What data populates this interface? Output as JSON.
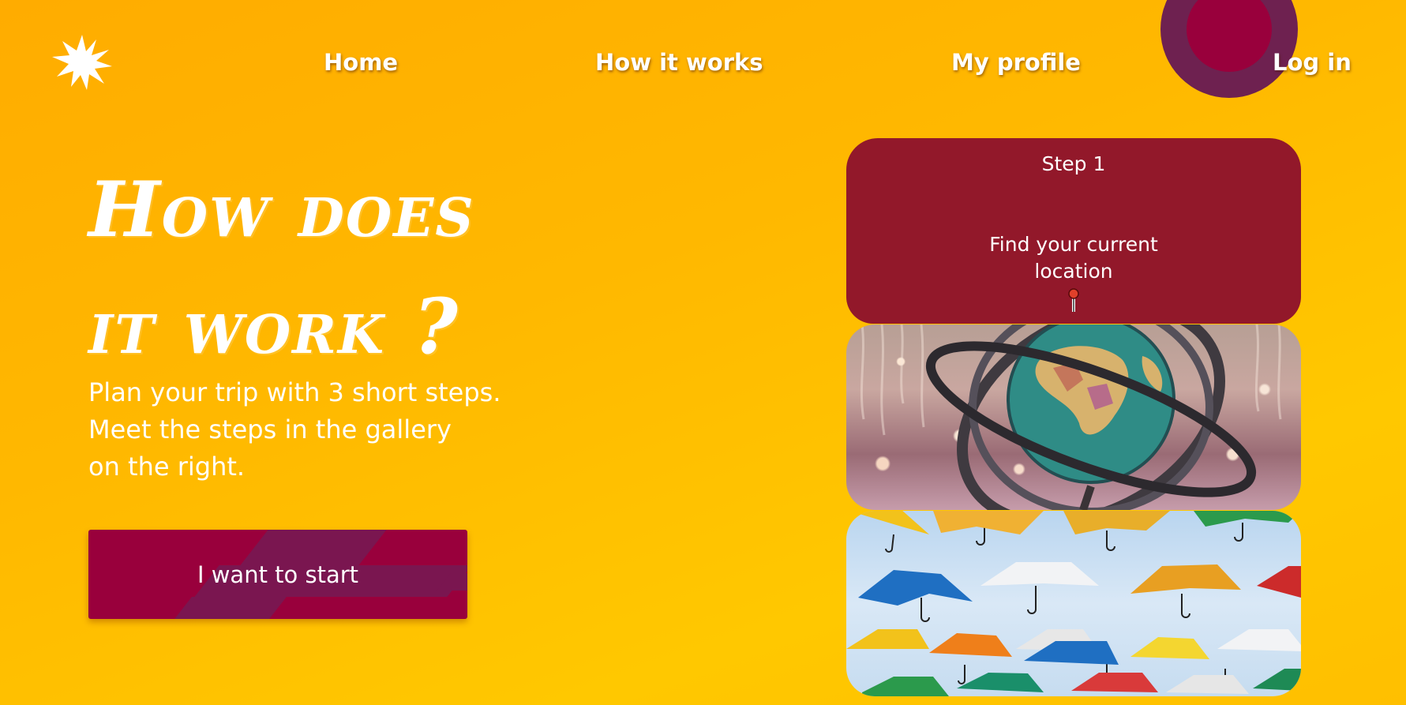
{
  "nav": {
    "home": "Home",
    "how_it_works": "How it works",
    "my_profile": "My profile",
    "log_in": "Log in"
  },
  "hero": {
    "title_line1": "How does",
    "title_line2": "it work ?",
    "text_line1": "Plan your trip with 3 short steps.",
    "text_line2": "Meet the steps in the gallery",
    "text_line3": "on the right.",
    "button_label": "I want to start"
  },
  "gallery": {
    "step_title": "Step 1",
    "step_desc_line1": "Find your current",
    "step_desc_line2": "location"
  },
  "icons": {
    "logo": "sun-star-icon",
    "step": "map-pin-icon"
  },
  "colors": {
    "background": "#ffb800",
    "accent": "#99003c",
    "card": "#92182a",
    "ring": "#6e2150"
  }
}
